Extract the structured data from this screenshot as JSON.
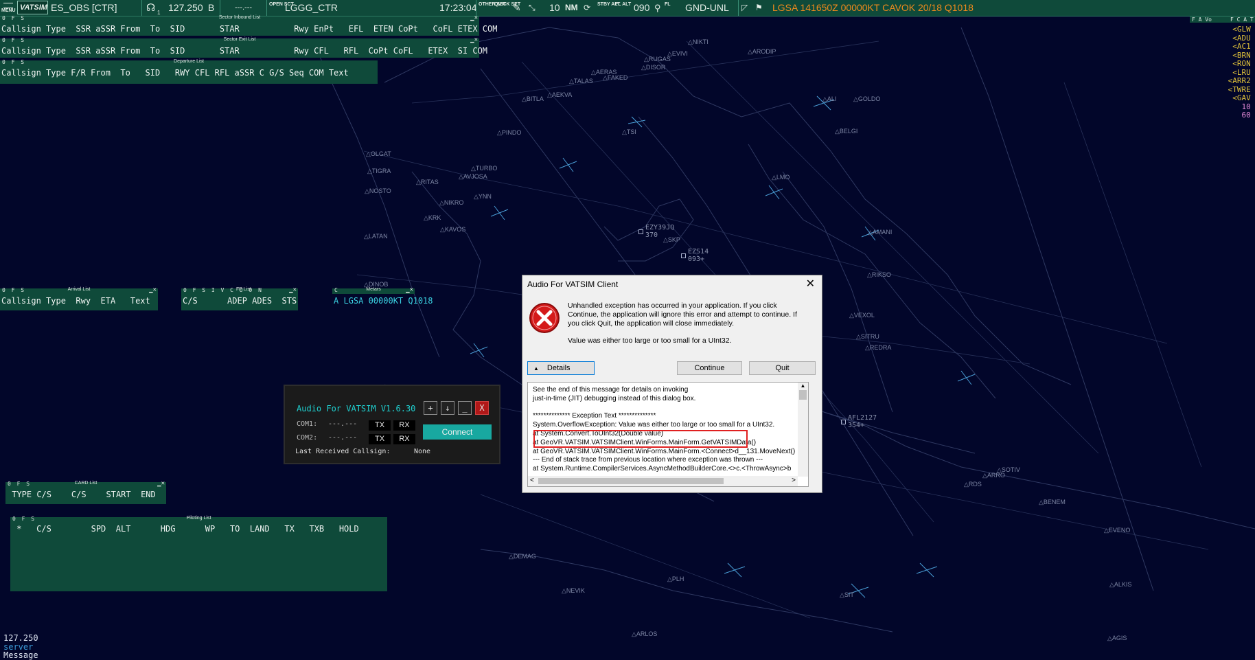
{
  "topbar": {
    "menu_label": "MENU",
    "logo_text": "VATSIM",
    "callsign": "ES_OBS [CTR]",
    "freq_sub": "1",
    "frequency": "127.250",
    "atis_letter": "B",
    "secondary_freq": "---.---",
    "open_sct_label": "OPEN SCT",
    "sector": "LGGG_CTR",
    "time": "17:23:04",
    "other_set_label": "OTHER SET",
    "quick_set_label": "QUICK SET",
    "range": "10",
    "range_unit": "NM",
    "stby_alt_label": "STBY ALT",
    "fl_alt_label": "FL ALT",
    "fl_value": "090",
    "fl_label": "FL",
    "gnd_unl": "GND-UNL",
    "metar": "LGSA 141650Z 00000KT CAVOK 20/18 Q1018",
    "right_flags": "F A Vo",
    "right_flags2": "F C A T"
  },
  "lists": {
    "sector_inbound": {
      "flags": "0 F S",
      "title": "Sector Inbound List",
      "header": "Callsign Type  SSR aSSR From  To  SID       STAR           Rwy EnPt   EFL  ETEN CoPt   CoFL ETEX COM"
    },
    "sector_exit": {
      "flags": "0 F S",
      "title": "Sector Exit List",
      "header": "Callsign Type  SSR aSSR From  To  SID       STAR           Rwy CFL   RFL  CoPt CoFL   ETEX  SI COM"
    },
    "departure": {
      "flags": "0 F S",
      "title": "Departure List",
      "header": "Callsign Type F/R From  To   SID   RWY CFL RFL aSSR C G/S Seq COM Text"
    },
    "arrival": {
      "flags": "0 F S",
      "title": "Arrival List",
      "header": "Callsign Type  Rwy  ETA   Text"
    },
    "fp": {
      "flags": "0 F S I V C U O N",
      "title": "FP List",
      "header": "C/S      ADEP ADES  STS"
    },
    "metars": {
      "flags": "C",
      "title": "Metars",
      "header": "A LGSA 00000KT Q1018"
    },
    "card": {
      "flags": "0 F S",
      "title": "CARD List",
      "header": " TYPE C/S    C/S    START  END"
    },
    "piloting": {
      "flags": "0 F S",
      "title": "Piloting List",
      "header": " *   C/S        SPD  ALT      HDG      WP   TO  LAND   TX   TXB   HOLD"
    }
  },
  "right_lines": [
    "<GLW G",
    "<ADU L",
    "<AC1 L",
    "<BRN L",
    "<RON L",
    "<LRU L",
    "<ARR2 L",
    "<TWRE L",
    "<GAV L",
    "10 L",
    "60 V"
  ],
  "waypoints": [
    "NIKTI",
    "EVIVI",
    "ARODIP",
    "RUGAS",
    "DISOR",
    "TALAS",
    "AERAS",
    "FAKED",
    "BITLA",
    "AEKVA",
    "ALI",
    "GOLDO",
    "PINDO",
    "TSI",
    "BELGI",
    "OLGAT",
    "TIGRA",
    "TURBO",
    "AVJOSA",
    "RITAS",
    "LMO",
    "NOSTO",
    "YNN",
    "NIKRO",
    "KRK",
    "KAVOS",
    "AMANI",
    "LATAN",
    "SKP",
    "RIKSO",
    "DINOB",
    "VEXOL",
    "SITRU",
    "REDRA",
    "SOTIV",
    "RDS",
    "ARRO",
    "BENEM",
    "EVENO",
    "DEMAG",
    "PLH",
    "NEVIK",
    "ALKIS",
    "SIT",
    "ARLOS",
    "AGIS"
  ],
  "traffic": [
    {
      "callsign": "EZY39JQ",
      "level": "370"
    },
    {
      "callsign": "EZS14",
      "level": "093+"
    },
    {
      "callsign": "AFL2127",
      "level": "354+"
    }
  ],
  "afv": {
    "title": "Audio For VATSIM V1.6.30",
    "btn_plus": "+",
    "btn_down": "↓",
    "btn_min": "_",
    "btn_close": "X",
    "com1_label": "COM1:",
    "com1_value": "---.---",
    "com2_label": "COM2:",
    "com2_value": "---.---",
    "tx": "TX",
    "rx": "RX",
    "connect": "Connect",
    "last_label": "Last Received Callsign:",
    "last_value": "None"
  },
  "dialog": {
    "title": "Audio For VATSIM Client",
    "close": "✕",
    "message": "Unhandled exception has occurred in your application. If you click Continue, the application will ignore this error and attempt to continue. If you click Quit, the application will close immediately.",
    "message2": "Value was either too large or too small for a UInt32.",
    "details_btn": "Details",
    "continue_btn": "Continue",
    "quit_btn": "Quit",
    "details_lines": [
      "See the end of this message for details on invoking",
      "just-in-time (JIT) debugging instead of this dialog box.",
      "",
      "************** Exception Text **************",
      "System.OverflowException: Value was either too large or too small for a UInt32.",
      "   at System.Convert.ToUInt32(Double value)",
      "   at GeoVR.VATSIM.VATSIMClient.WinForms.MainForm.GetVATSIMData()",
      "   at GeoVR.VATSIM.VATSIMClient.WinForms.MainForm.<Connect>d__131.MoveNext()",
      "--- End of stack trace from previous location where exception was thrown ---",
      "   at System.Runtime.CompilerServices.AsyncMethodBuilderCore.<>c.<ThrowAsync>b"
    ]
  },
  "bottom": {
    "freq": "127.250",
    "server": "server",
    "message": "Message"
  }
}
